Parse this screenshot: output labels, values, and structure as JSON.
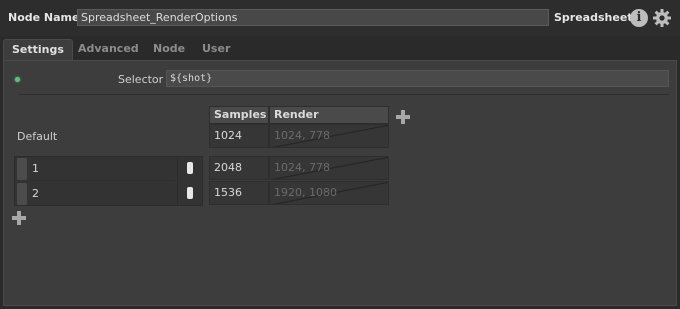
{
  "header": {
    "node_name_label": "Node Name",
    "node_name_value": "Spreadsheet_RenderOptions",
    "node_type": "Spreadsheet",
    "info_glyph": "i"
  },
  "tabs": [
    {
      "label": "Settings",
      "active": true
    },
    {
      "label": "Advanced",
      "active": false
    },
    {
      "label": "Node",
      "active": false
    },
    {
      "label": "User",
      "active": false
    }
  ],
  "settings": {
    "selector_label": "Selector",
    "selector_value": "${shot}",
    "columns": [
      "Samples",
      "Render Resolution"
    ],
    "default_row": {
      "label": "Default",
      "samples": "1024",
      "render_resolution": "1024, 778"
    },
    "rows": [
      {
        "name": "1",
        "samples": "2048",
        "render_resolution": "1024, 778"
      },
      {
        "name": "2",
        "samples": "1536",
        "render_resolution": "1920, 1080"
      }
    ]
  },
  "colors": {
    "status_led": "#5fbf7f",
    "panel_bg": "#3d3d3d"
  }
}
